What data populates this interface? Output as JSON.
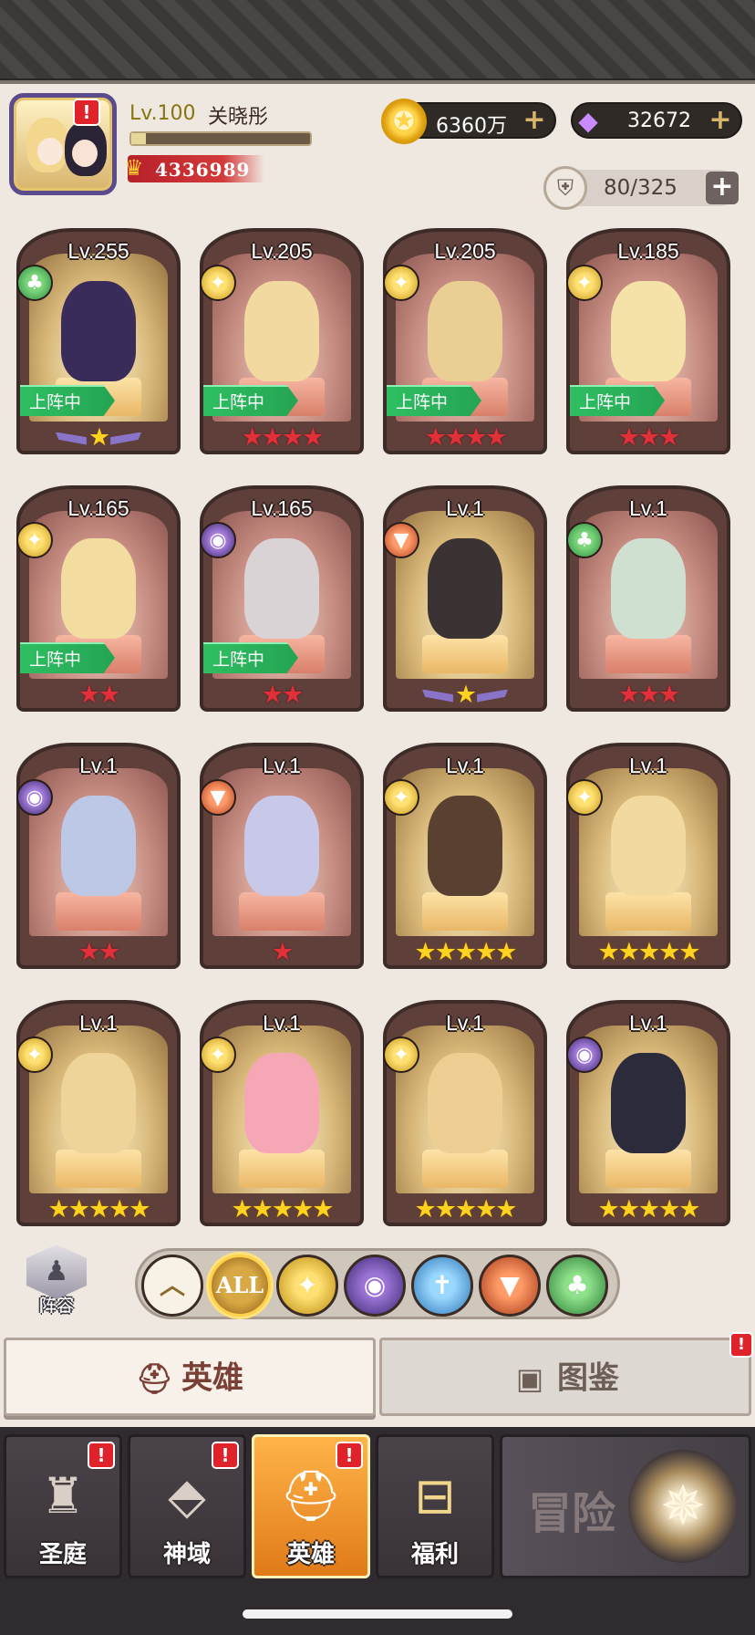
{
  "player": {
    "level": "Lv.100",
    "name": "关晓彤",
    "power": "4336989",
    "avatar_alert": "!"
  },
  "currencies": {
    "gold": "6360万",
    "gems": "32672",
    "plus": "+"
  },
  "capacity": {
    "value": "80/325",
    "plus": "+"
  },
  "deployed_label": "上阵中",
  "heroes": [
    {
      "level": "Lv.255",
      "faction": "tree",
      "stars": "★",
      "star_style": "wing",
      "deployed": true,
      "bg": "gold"
    },
    {
      "level": "Lv.205",
      "faction": "gold",
      "stars": "★★★★",
      "star_style": "red",
      "deployed": true,
      "bg": "red"
    },
    {
      "level": "Lv.205",
      "faction": "gold",
      "stars": "★★★★",
      "star_style": "red",
      "deployed": true,
      "bg": "red"
    },
    {
      "level": "Lv.185",
      "faction": "gold",
      "stars": "★★★",
      "star_style": "red",
      "deployed": true,
      "bg": "red"
    },
    {
      "level": "Lv.165",
      "faction": "gold",
      "stars": "★★",
      "star_style": "red",
      "deployed": true,
      "bg": "red"
    },
    {
      "level": "Lv.165",
      "faction": "dark",
      "stars": "★★",
      "star_style": "red",
      "deployed": true,
      "bg": "red"
    },
    {
      "level": "Lv.1",
      "faction": "fox",
      "stars": "★",
      "star_style": "wing",
      "deployed": false,
      "bg": "gold"
    },
    {
      "level": "Lv.1",
      "faction": "tree",
      "stars": "★★★",
      "star_style": "red",
      "deployed": false,
      "bg": "red"
    },
    {
      "level": "Lv.1",
      "faction": "dark",
      "stars": "★★",
      "star_style": "red",
      "deployed": false,
      "bg": "red"
    },
    {
      "level": "Lv.1",
      "faction": "fox",
      "stars": "★",
      "star_style": "red",
      "deployed": false,
      "bg": "red"
    },
    {
      "level": "Lv.1",
      "faction": "gold",
      "stars": "★★★★★",
      "star_style": "gold",
      "deployed": false,
      "bg": "gold"
    },
    {
      "level": "Lv.1",
      "faction": "gold",
      "stars": "★★★★★",
      "star_style": "gold",
      "deployed": false,
      "bg": "gold"
    },
    {
      "level": "Lv.1",
      "faction": "gold",
      "stars": "★★★★★",
      "star_style": "gold",
      "deployed": false,
      "bg": "gold"
    },
    {
      "level": "Lv.1",
      "faction": "gold",
      "stars": "★★★★★",
      "star_style": "gold",
      "deployed": false,
      "bg": "gold"
    },
    {
      "level": "Lv.1",
      "faction": "gold",
      "stars": "★★★★★",
      "star_style": "gold",
      "deployed": false,
      "bg": "gold"
    },
    {
      "level": "Lv.1",
      "faction": "dark",
      "stars": "★★★★★",
      "star_style": "gold",
      "deployed": false,
      "bg": "gold"
    }
  ],
  "lineup": {
    "label": "阵容"
  },
  "filters": {
    "all_label": "ALL"
  },
  "tabs": {
    "heroes": "英雄",
    "codex": "图鉴",
    "codex_alert": "!"
  },
  "nav": {
    "court": "圣庭",
    "realm": "神域",
    "heroes": "英雄",
    "welfare": "福利",
    "adventure": "冒险",
    "alert": "!"
  }
}
